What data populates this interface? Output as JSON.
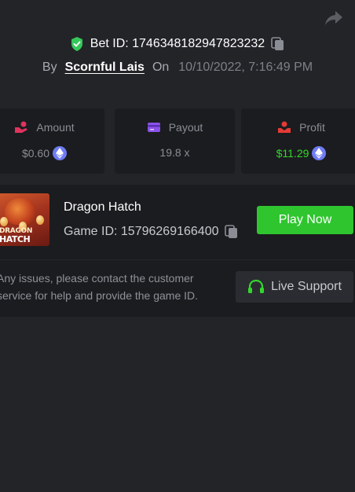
{
  "header": {
    "bet_id_label": "Bet ID: 1746348182947823232",
    "by_label": "By",
    "username": "Scornful Lais",
    "on_label": "On",
    "date": "10/10/2022, 7:16:49 PM"
  },
  "stats": [
    {
      "label": "Amount",
      "value": "$0.60",
      "icon": "hand-coins-icon",
      "icon_color": "#e0335e",
      "value_color": "#8b8d95"
    },
    {
      "label": "Payout",
      "value": "19.8 x",
      "icon": "card-icon",
      "icon_color": "#8b52e8",
      "value_color": "#8b8d95"
    },
    {
      "label": "Profit",
      "value": "$11.29",
      "icon": "hand-profit-icon",
      "icon_color": "#e53b35",
      "value_color": "#33d62d"
    }
  ],
  "game": {
    "thumbnail_text_line1": "DRAGON",
    "thumbnail_text_line2": "HATCH",
    "title": "Dragon Hatch",
    "game_id_label": "Game ID: 15796269166400",
    "play_button": "Play Now"
  },
  "support": {
    "help_text": "Any issues, please contact the customer service for help and provide the game ID.",
    "button_label": "Live Support"
  },
  "colors": {
    "background": "#232428",
    "card": "#1b1c1f",
    "accent_green": "#2fc52f",
    "eth_badge": "#6f7cf3",
    "verified_green": "#35c759"
  }
}
